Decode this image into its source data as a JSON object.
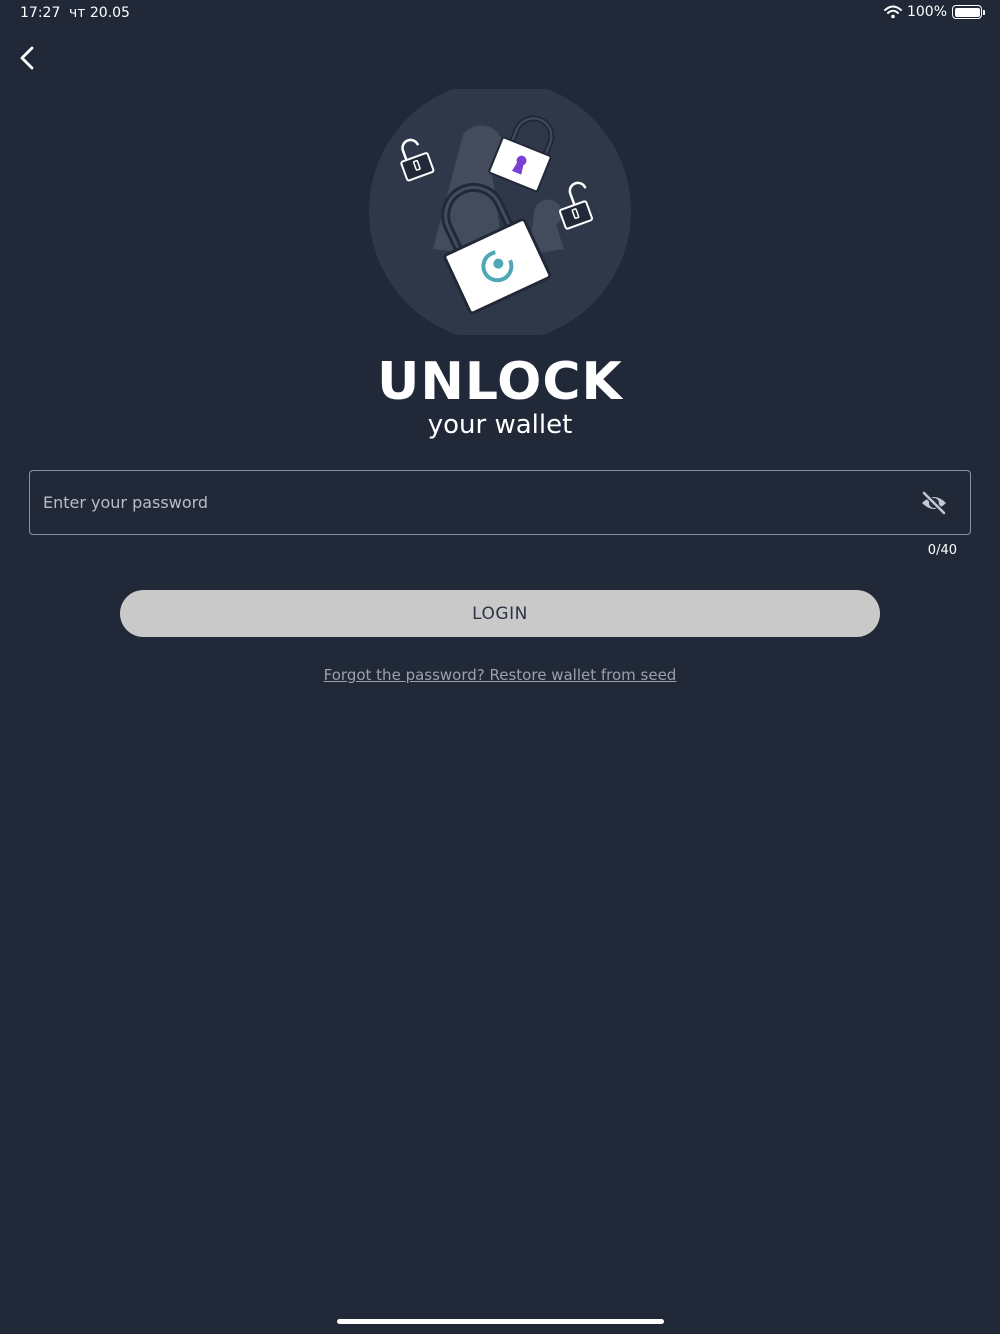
{
  "status_bar": {
    "time": "17:27",
    "date": "чт 20.05",
    "battery": "100%",
    "icons": [
      "wifi-icon",
      "battery-icon"
    ]
  },
  "nav": {
    "back_icon": "chevron-left-icon"
  },
  "illustration": {
    "icon": "padlocks-illustration"
  },
  "heading": {
    "title": "UNLOCK",
    "subtitle": "your wallet"
  },
  "password": {
    "placeholder": "Enter your password",
    "value": "",
    "counter": "0/40",
    "toggle_icon": "eye-off-icon"
  },
  "login": {
    "label": "LOGIN"
  },
  "restore": {
    "link": "Forgot the password? Restore wallet from seed"
  },
  "colors": {
    "background": "#212939",
    "button": "#c9c9c9",
    "button_text": "#2b3346",
    "link": "#9aa1ad",
    "accent_teal": "#4fa8b3",
    "accent_purple": "#7b3fd6"
  }
}
